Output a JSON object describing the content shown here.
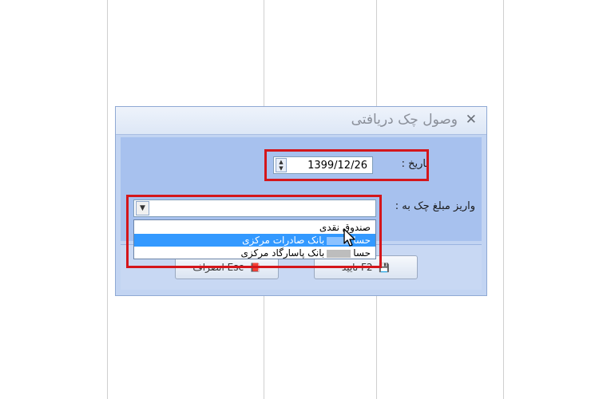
{
  "dialog": {
    "title": "وصول چک دریافتی",
    "close_symbol": "✕"
  },
  "form": {
    "date_label": "تاریخ :",
    "date_value": "1399/12/26",
    "deposit_label": "واریز مبلغ چک به :",
    "combo_value": ""
  },
  "dropdown": {
    "options": [
      {
        "label": "صندوق نقدی",
        "selected": false
      },
      {
        "prefix": "حسا",
        "label": "بانک صادرات مرکزی",
        "selected": true
      },
      {
        "prefix": "حسا",
        "label": "بانک پاسارگاد مرکزی",
        "selected": false
      }
    ]
  },
  "buttons": {
    "confirm": "تایید F2",
    "cancel": "انصراف Esc"
  },
  "colors": {
    "highlight": "#d4161b",
    "selection": "#3399ff",
    "dialog_bg": "#c2d4f2"
  },
  "icons": [
    "close-icon",
    "spin-icon",
    "chevron-down-icon",
    "save-icon",
    "cancel-icon",
    "cursor-icon"
  ]
}
